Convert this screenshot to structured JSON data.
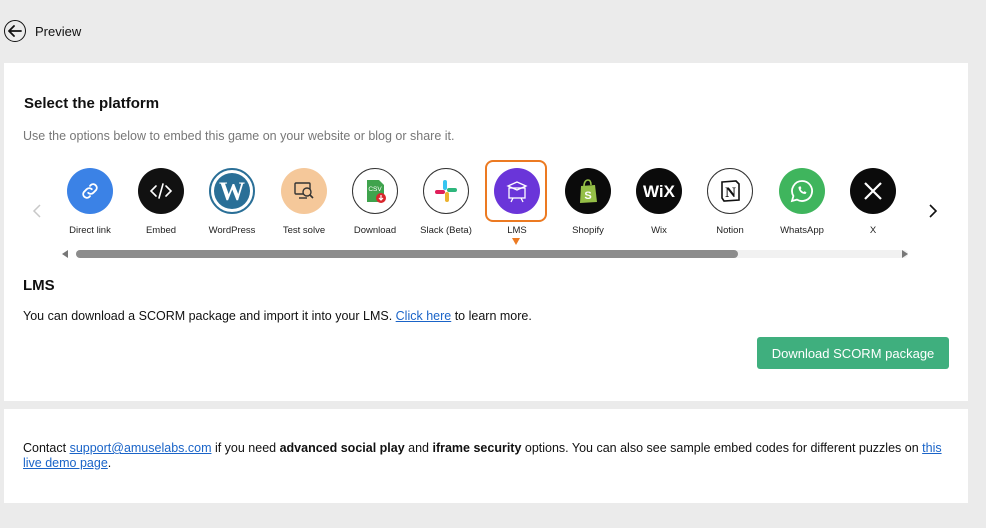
{
  "header": {
    "back_label": "Preview"
  },
  "panel": {
    "title": "Select the platform",
    "subtitle": "Use the options below to embed this game on your website or blog or share it."
  },
  "platforms": [
    {
      "label": "Direct link",
      "icon": "link-icon",
      "bg": "#3b82e6"
    },
    {
      "label": "Embed",
      "icon": "code-icon",
      "bg": "#111111"
    },
    {
      "label": "WordPress",
      "icon": "wordpress-icon",
      "bg": "#2a6f97"
    },
    {
      "label": "Test solve",
      "icon": "test-solve-icon",
      "bg": "#f5c89a"
    },
    {
      "label": "Download",
      "icon": "csv-download-icon",
      "bg": "#ffffff"
    },
    {
      "label": "Slack (Beta)",
      "icon": "slack-icon",
      "bg": "#ffffff"
    },
    {
      "label": "LMS",
      "icon": "graduation-cap-icon",
      "bg": "#6a35d9",
      "selected": true
    },
    {
      "label": "Shopify",
      "icon": "shopify-icon",
      "bg": "#0b0b0b"
    },
    {
      "label": "Wix",
      "icon": "wix-icon",
      "bg": "#0b0b0b"
    },
    {
      "label": "Notion",
      "icon": "notion-icon",
      "bg": "#ffffff"
    },
    {
      "label": "WhatsApp",
      "icon": "whatsapp-icon",
      "bg": "#3fb55d"
    },
    {
      "label": "X",
      "icon": "x-icon",
      "bg": "#0b0b0b"
    }
  ],
  "section": {
    "title": "LMS",
    "desc_before": "You can download a SCORM package and import it into your LMS. ",
    "desc_link": "Click here",
    "desc_after": " to learn more.",
    "button_label": "Download SCORM package",
    "button_color": "#3faf7e",
    "selection_color": "#ec7a22"
  },
  "footer": {
    "t1": "Contact ",
    "email": "support@amuselabs.com",
    "t2": " if you need ",
    "b1": "advanced social play",
    "t3": " and ",
    "b2": "iframe security",
    "t4": " options. You can also see sample embed codes for different puzzles on ",
    "demo_link": "this live demo page",
    "t5": "."
  }
}
